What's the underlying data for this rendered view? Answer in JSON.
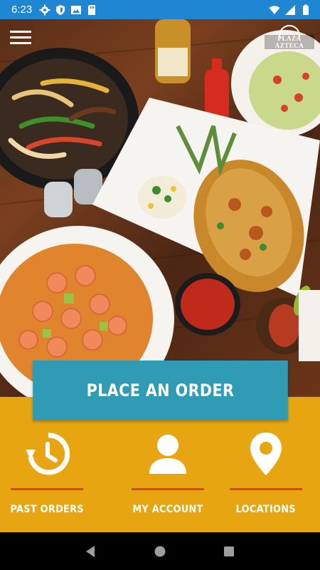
{
  "status_bar": {
    "time": "6:23",
    "left_icons": [
      "gear-icon",
      "shield-icon",
      "image-icon",
      "sd-card-icon"
    ],
    "right_icons": [
      "wifi-icon",
      "signal-icon",
      "battery-icon"
    ],
    "background": "#1f86d3"
  },
  "header": {
    "menu_icon": "hamburger-menu-icon",
    "logo_text": "PLAZA AZTECA"
  },
  "main": {
    "order_button_label": "PLACE AN ORDER",
    "order_button_color": "#2f9bb4",
    "panel_color": "#e7a611",
    "accent_line_color": "#e0402a"
  },
  "nav": {
    "items": [
      {
        "label": "PAST ORDERS",
        "icon": "history-icon"
      },
      {
        "label": "MY ACCOUNT",
        "icon": "user-icon"
      },
      {
        "label": "LOCATIONS",
        "icon": "location-pin-icon"
      }
    ]
  },
  "system_nav": {
    "buttons": [
      "back-icon",
      "home-icon",
      "recents-icon"
    ]
  }
}
